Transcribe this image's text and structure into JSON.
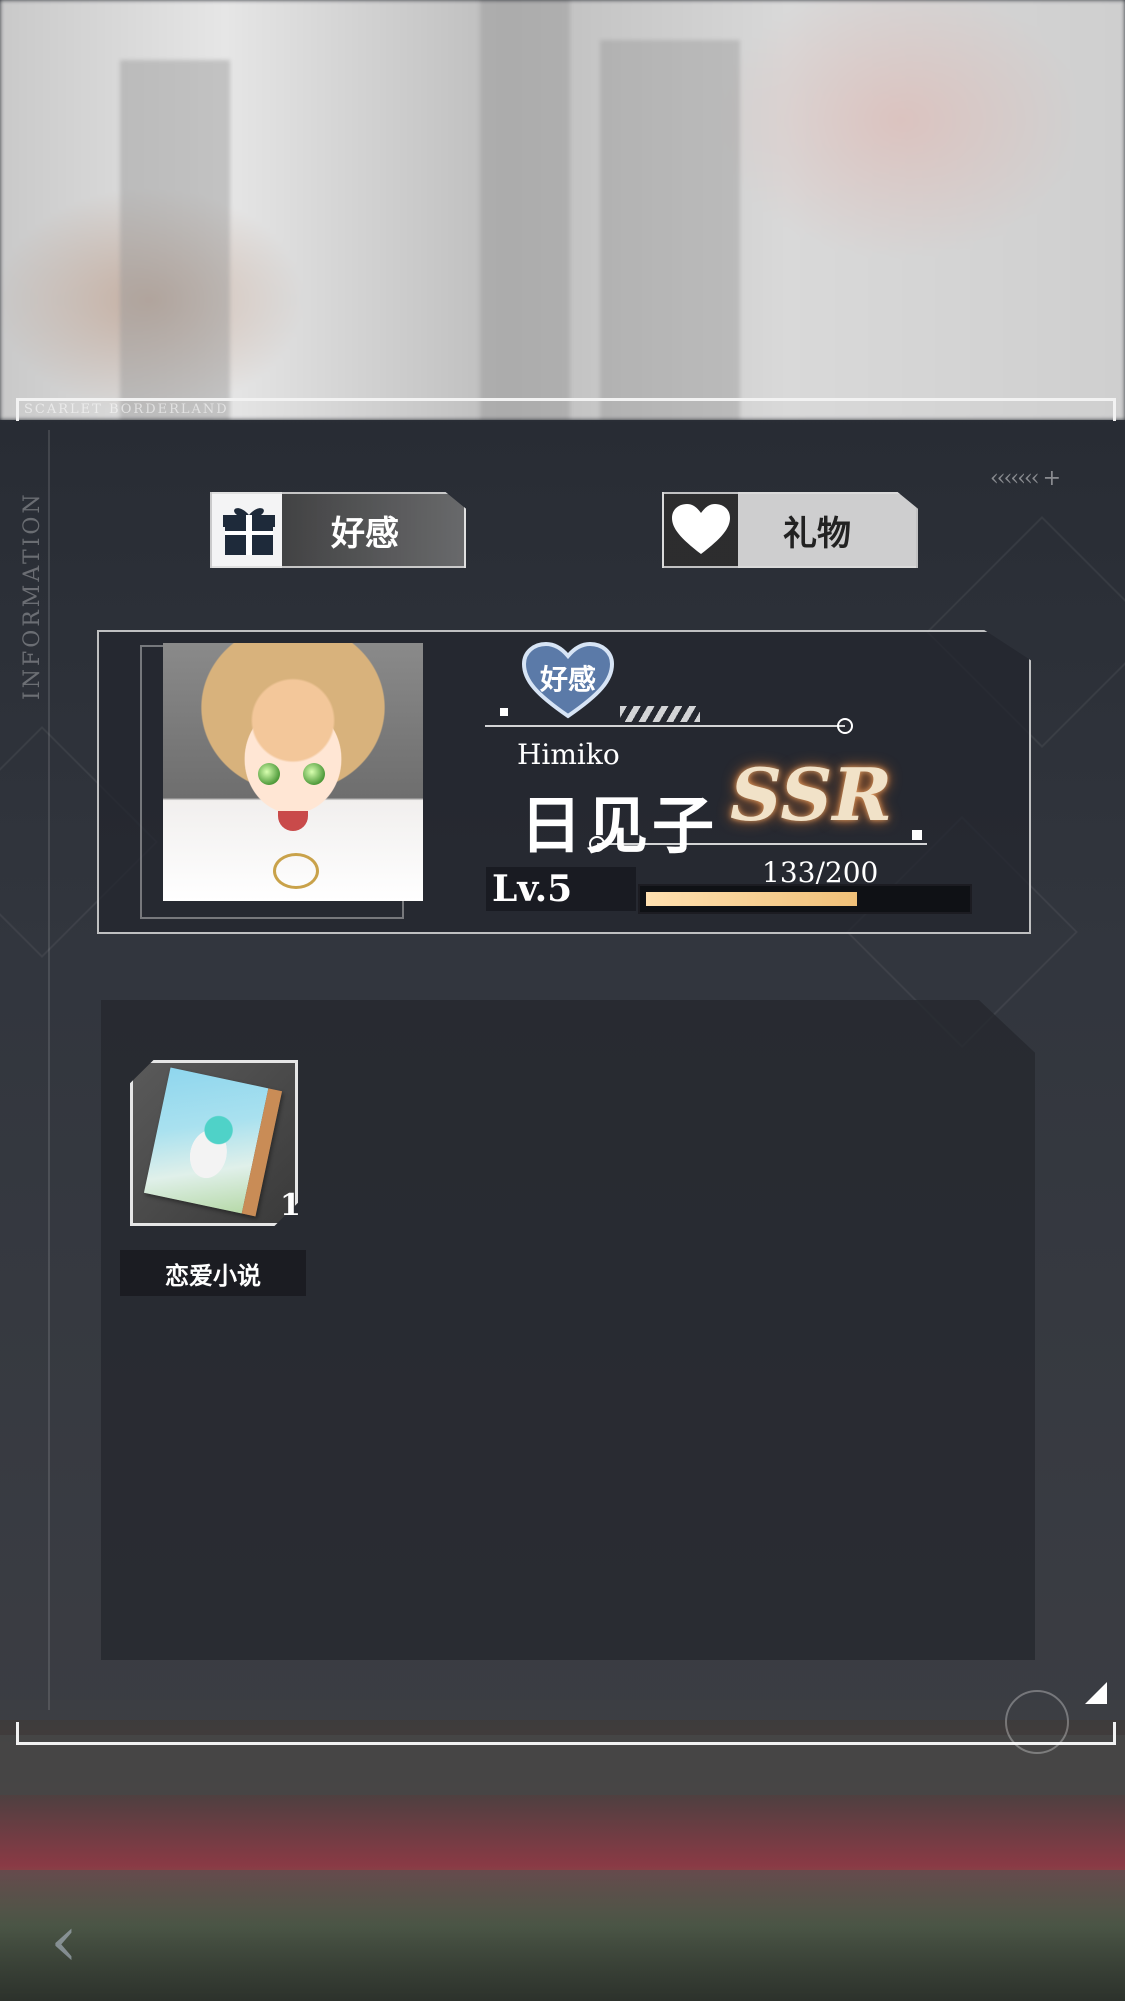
{
  "brand_text": "SCARLET BORDERLAND",
  "side_label": "INFORMATION",
  "tabs": [
    {
      "label": "好感",
      "icon": "gift-icon"
    },
    {
      "label": "礼物",
      "icon": "heart-icon"
    }
  ],
  "character": {
    "badge": "好感",
    "name_en": "Himiko",
    "name_cn": "日见子",
    "rarity": "SSR",
    "level": "Lv.5",
    "exp_text": "133/200",
    "exp_fraction": 0.665
  },
  "items": [
    {
      "name": "恋爱小说",
      "count": "1",
      "icon": "book-icon"
    }
  ]
}
